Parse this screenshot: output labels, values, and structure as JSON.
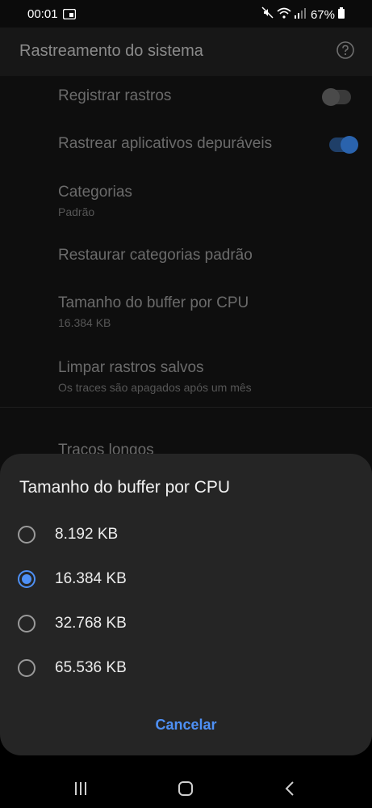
{
  "status_bar": {
    "time": "00:01",
    "battery": "67%",
    "icons": [
      "screen-record-icon",
      "mute-icon",
      "wifi-icon",
      "signal-icon",
      "battery-icon"
    ]
  },
  "app_bar": {
    "title": "Rastreamento do sistema",
    "help_icon": "help-icon"
  },
  "settings": {
    "record_traces": {
      "title": "Registrar rastros",
      "toggle_on": false
    },
    "trace_debuggable": {
      "title": "Rastrear aplicativos depuráveis",
      "toggle_on": true
    },
    "categories": {
      "title": "Categorias",
      "subtitle": "Padrão"
    },
    "restore_categories": {
      "title": "Restaurar categorias padrão"
    },
    "buffer_size": {
      "title": "Tamanho do buffer por CPU",
      "subtitle": "16.384 KB"
    },
    "clear_traces": {
      "title": "Limpar rastros salvos",
      "subtitle": "Os traces são apagados após um mês"
    },
    "long_traces": {
      "title": "Traços longos"
    }
  },
  "dialog": {
    "title": "Tamanho do buffer por CPU",
    "options": [
      {
        "label": "8.192 KB",
        "selected": false
      },
      {
        "label": "16.384 KB",
        "selected": true
      },
      {
        "label": "32.768 KB",
        "selected": false
      },
      {
        "label": "65.536 KB",
        "selected": false
      }
    ],
    "cancel_label": "Cancelar"
  },
  "nav_bar": {
    "buttons": [
      "recent-apps-icon",
      "home-icon",
      "back-icon"
    ]
  },
  "colors": {
    "accent": "#4e90f5",
    "dialog_bg": "#252525",
    "page_bg": "#0e0e0e"
  }
}
